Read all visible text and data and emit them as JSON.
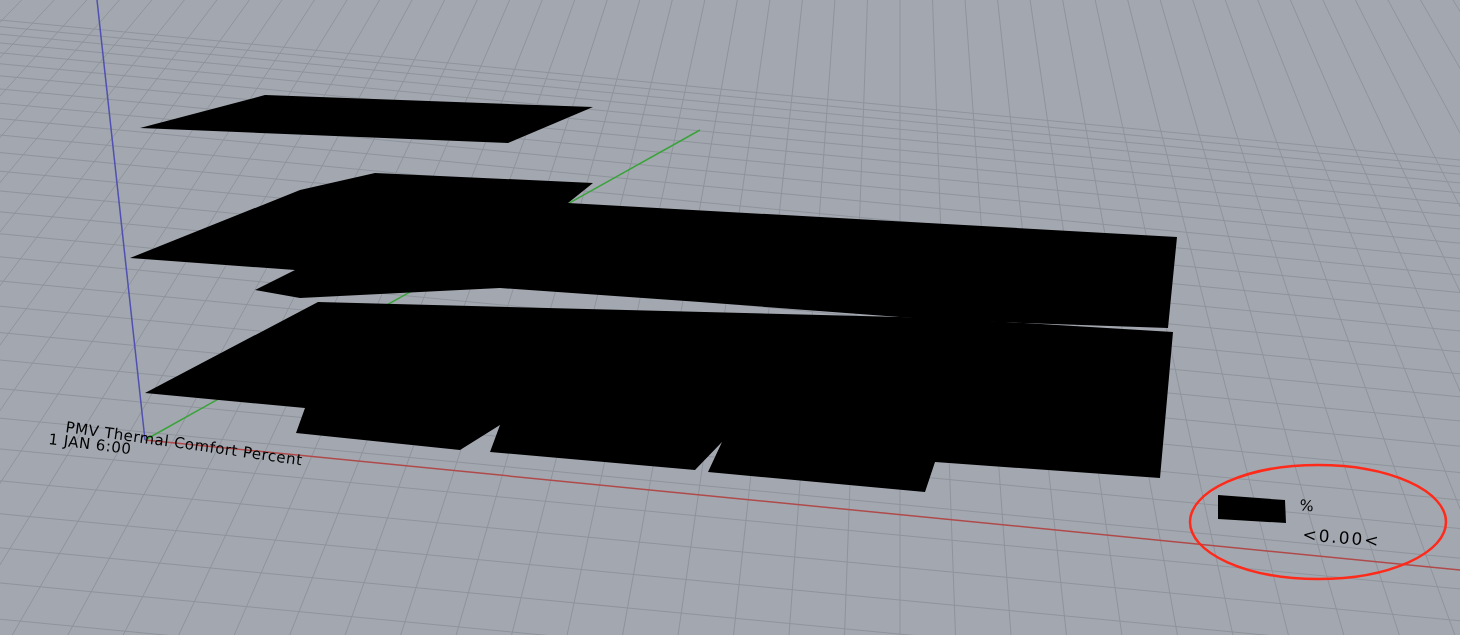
{
  "viewport_labels": {
    "title": "PMV Thermal Comfort Percent",
    "date_time": "1 JAN 6:00"
  },
  "legend": {
    "unit": "%",
    "swatch": {
      "color": "#000000",
      "label": "<0.00<"
    }
  }
}
